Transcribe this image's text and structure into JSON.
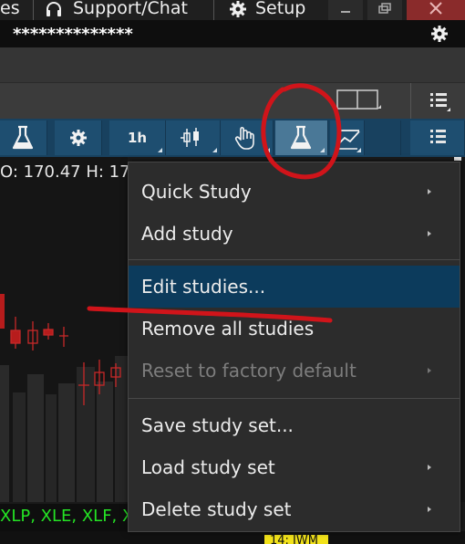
{
  "topbar": {
    "tab_partial": "es",
    "support": "Support/Chat",
    "setup": "Setup"
  },
  "account": {
    "masked": "**************"
  },
  "quote": {
    "text": "O: 170.47  H: 17"
  },
  "toolbar": {
    "timeframe": "1h"
  },
  "menu": {
    "items": [
      {
        "label": "Quick Study",
        "submenu": true,
        "disabled": false
      },
      {
        "label": "Add study",
        "submenu": true,
        "disabled": false
      },
      {
        "label": "Edit studies...",
        "submenu": false,
        "disabled": false,
        "highlighted": true
      },
      {
        "label": "Remove all studies",
        "submenu": false,
        "disabled": false
      },
      {
        "label": "Reset to factory default",
        "submenu": true,
        "disabled": true
      },
      {
        "label": "Save study set...",
        "submenu": false,
        "disabled": false
      },
      {
        "label": "Load study set",
        "submenu": true,
        "disabled": false
      },
      {
        "label": "Delete study set",
        "submenu": true,
        "disabled": false
      }
    ]
  },
  "watchlist": {
    "symbols": "XLP, XLE, XLF, X"
  },
  "tag": {
    "text": "14: IWM"
  },
  "colors": {
    "toolbar": "#18415f",
    "highlight": "#0c3b5c",
    "annotation": "#d0141a",
    "symbols": "#24e424"
  }
}
